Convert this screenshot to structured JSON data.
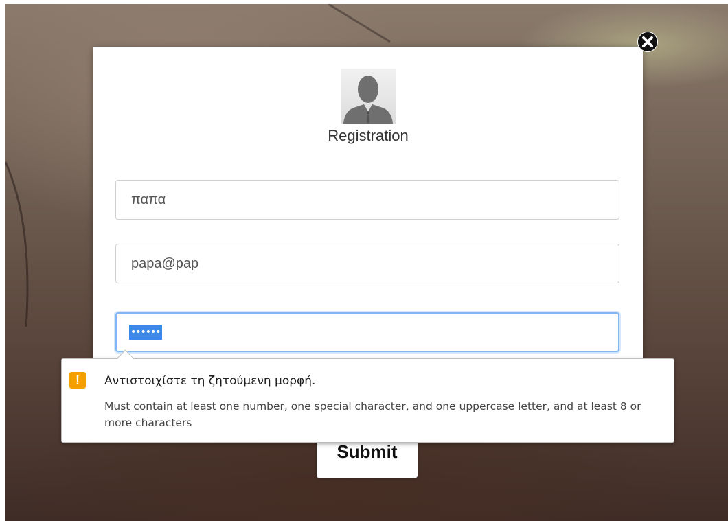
{
  "modal": {
    "title": "Registration",
    "close_icon": "close-circle-icon",
    "avatar_icon": "user-silhouette-icon"
  },
  "form": {
    "username": {
      "value": "παπα"
    },
    "email": {
      "value": "papa@pap"
    },
    "password": {
      "masked_value": "••••••",
      "selected": true
    },
    "submit_label": "Submit"
  },
  "validation_tooltip": {
    "icon": "warning-icon",
    "icon_glyph": "!",
    "title": "Αντιστοιχίστε τη ζητούμενη μορφή.",
    "detail": "Must contain at least one number, one special character, and one uppercase letter, and at least 8 or more characters"
  },
  "colors": {
    "focus_ring": "#80b6f5",
    "selection": "#3b88e8",
    "warning": "#f4a100"
  }
}
